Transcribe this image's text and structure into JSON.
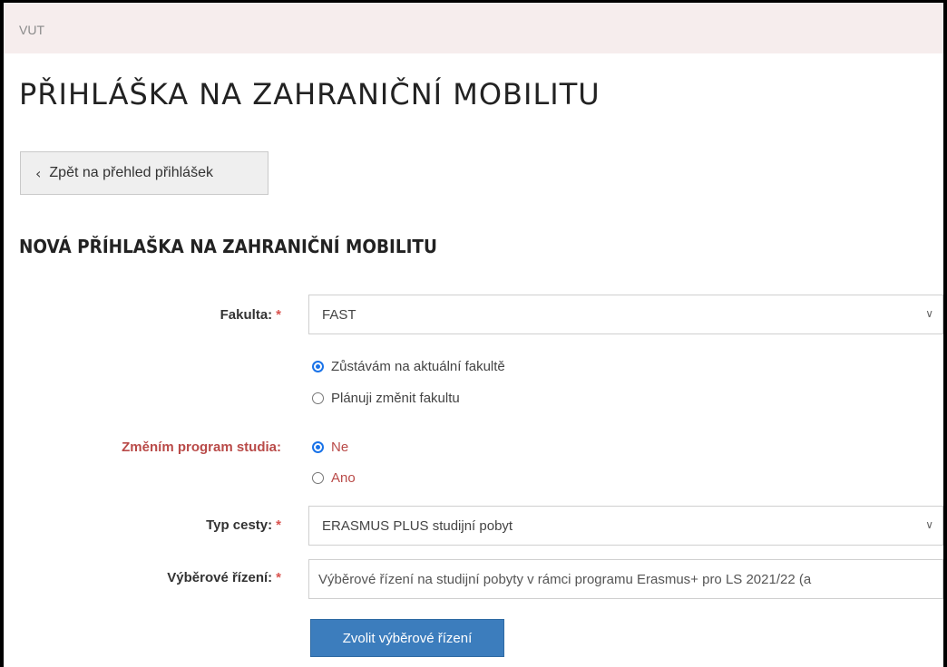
{
  "topbar": {
    "text": "VUT"
  },
  "page_title": "PŘIHLÁŠKA NA ZAHRANIČNÍ MOBILITU",
  "back_button": {
    "icon": "chevron-left-icon",
    "label": "Zpět na přehled přihlášek"
  },
  "section_title": "NOVÁ PŘÍHLAŠKA NA ZAHRANIČNÍ MOBILITU",
  "form": {
    "faculty": {
      "label": "Fakulta:",
      "required_mark": "*",
      "value": "FAST",
      "options": [
        {
          "label": "Zůstávám na aktuální fakultě",
          "checked": true
        },
        {
          "label": "Plánuji změnit fakultu",
          "checked": false
        }
      ]
    },
    "program_change": {
      "label": "Změním program studia:",
      "options": [
        {
          "label": "Ne",
          "checked": true
        },
        {
          "label": "Ano",
          "checked": false
        }
      ]
    },
    "trip_type": {
      "label": "Typ cesty:",
      "required_mark": "*",
      "value": "ERASMUS PLUS studijní pobyt"
    },
    "selection": {
      "label": "Výběrové řízení:",
      "required_mark": "*",
      "value": "Výběrové řízení na studijní pobyty v rámci programu Erasmus+ pro LS 2021/22 (a"
    },
    "choose_button": "Zvolit výběrové řízení"
  },
  "colors": {
    "accent": "#1a73e8",
    "primary_button": "#3c7dbd",
    "danger_label": "#b94a48",
    "required": "#d9534f",
    "topbar_bg": "#f6eded"
  }
}
